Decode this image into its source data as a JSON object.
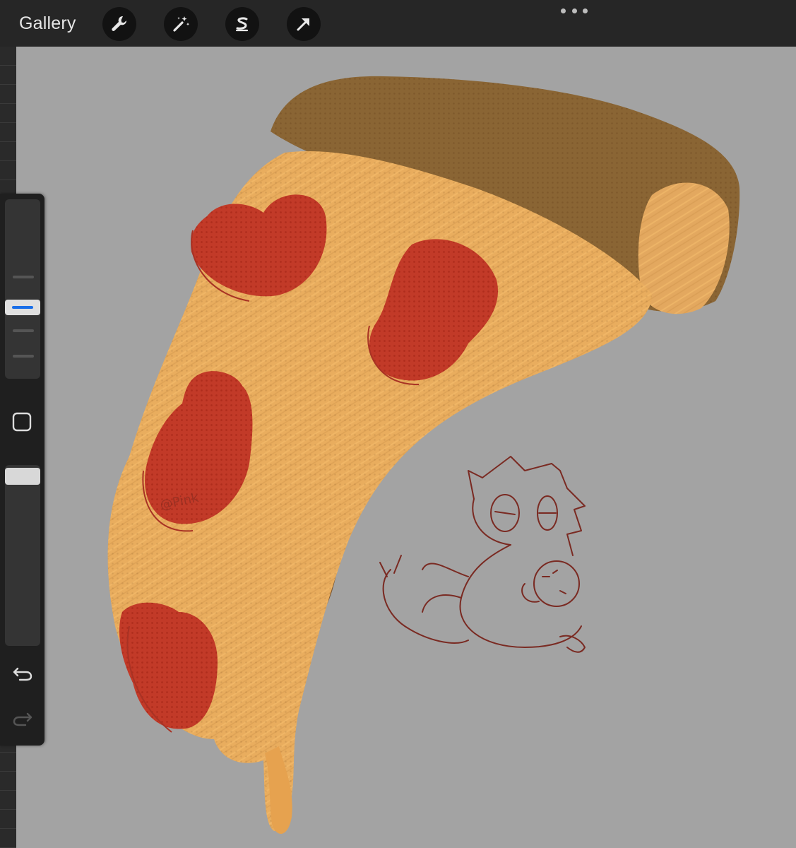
{
  "topbar": {
    "gallery_label": "Gallery",
    "tools": [
      {
        "name": "actions",
        "icon": "wrench-icon"
      },
      {
        "name": "adjustments",
        "icon": "magic-wand-icon"
      },
      {
        "name": "selection",
        "icon": "selection-s-icon"
      },
      {
        "name": "transform",
        "icon": "arrow-cursor-icon"
      }
    ],
    "more_icon": "more-dots-icon"
  },
  "sidebar": {
    "brush_size_slider": {
      "icon": "brush-size-slider"
    },
    "modify_button": {
      "icon": "square-icon"
    },
    "opacity_slider": {
      "icon": "opacity-slider"
    },
    "undo": {
      "icon": "undo-icon"
    },
    "redo": {
      "icon": "redo-icon",
      "enabled": false
    }
  },
  "colors": {
    "topbar": "#262626",
    "canvas": "#a3a3a3",
    "accent": "#1a6fe8",
    "cheese": "#e9ad5e",
    "crust": "#8a6534",
    "pepperoni": "#c23a28",
    "sketch_line": "#7a2a22"
  },
  "canvas": {
    "artwork": "pizza-slice-painting",
    "sketch": "cat-hugging-pizza-sketch",
    "signature": "@Pink"
  }
}
